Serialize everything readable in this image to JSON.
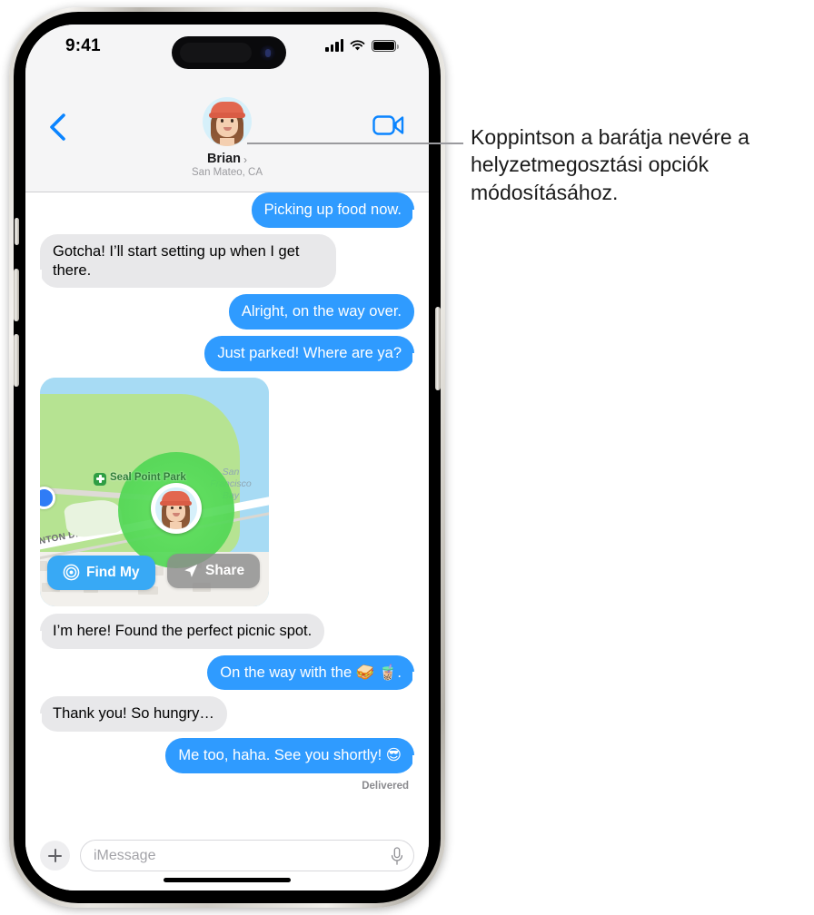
{
  "status_bar": {
    "time": "9:41",
    "icons": [
      "cellular-signal-icon",
      "wifi-icon",
      "battery-icon"
    ]
  },
  "header": {
    "back_icon": "back-chevron-icon",
    "facetime_icon": "video-camera-icon",
    "contact_name": "Brian",
    "contact_chevron": "›",
    "contact_location": "San Mateo, CA",
    "avatar": "memoji-avatar"
  },
  "thread": {
    "messages": [
      {
        "id": "m1",
        "side": "out",
        "text": "Picking up food now.",
        "tail": true
      },
      {
        "id": "m2",
        "side": "in",
        "text": "Gotcha! I’ll start setting up when I get there.",
        "tail": true
      },
      {
        "id": "m3",
        "side": "out",
        "text": "Alright, on the way over.",
        "tail": false
      },
      {
        "id": "m4",
        "side": "out",
        "text": "Just parked! Where are ya?",
        "tail": true
      },
      {
        "id": "m6",
        "side": "in",
        "text": "I’m here! Found the perfect picnic spot.",
        "tail": true
      },
      {
        "id": "m7",
        "side": "out",
        "text": "On the way with the 🥪 🧋.",
        "tail": true
      },
      {
        "id": "m8",
        "side": "in",
        "text": "Thank you! So hungry…",
        "tail": true
      },
      {
        "id": "m9",
        "side": "out",
        "text": "Me too, haha. See you shortly! 😎",
        "tail": true
      }
    ],
    "delivered_label": "Delivered"
  },
  "map_attachment": {
    "park_label": "Seal Point Park",
    "bay_label": "San Francisco Bay",
    "street_label": "INTON DR",
    "park_icon": "park-marker-icon",
    "friend_pin": "friend-location-pin",
    "self_dot": "current-location-dot",
    "find_my_button": {
      "label": "Find My",
      "icon": "findmy-radar-icon"
    },
    "share_button": {
      "label": "Share",
      "icon": "share-arrow-icon"
    }
  },
  "composer": {
    "plus_icon": "plus-icon",
    "placeholder": "iMessage",
    "value": "",
    "mic_icon": "microphone-icon"
  },
  "callout": {
    "text": "Koppintson a barátja nevére a helyzetmegosztási opciók módosításához."
  },
  "colors": {
    "outgoing_bubble": "#2f9bff",
    "incoming_bubble": "#e8e8ea",
    "accent_blue": "#2f9bff",
    "header_bg": "#f5f5f6",
    "find_my_blue": "#38a9f5",
    "geofence_green": "#53d957"
  }
}
